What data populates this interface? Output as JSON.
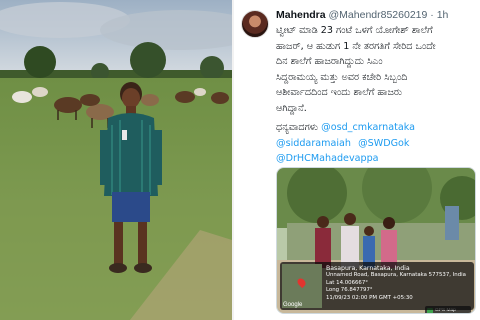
{
  "tweet": {
    "display_name": "Mahendra",
    "handle": "@Mahendr85260219",
    "separator": "·",
    "time": "1h",
    "body_lines": [
      "ಟ್ವೀಟ್ ಮಾಡಿ 23 ಗಂಟೆ ಒಳಗೆ ಯೋಗೇಶ್ ಶಾಲೆಗೆ",
      "ಹಾಜರ್, ಆ ಹುಡುಗ 1 ನೇ ತರಗತಿಗೆ ಸೇರಿದ ಒಂದೇ",
      "ದಿನ ಶಾಲೆಗೆ ಹಾಜರಾಗಿದ್ದುದು ಸಿಎಂ",
      "ಸಿದ್ದರಾಮಯ್ಯ ಮತ್ತು ಅವರ ಕಚೇರಿ ಸಿಬ್ಬಂದಿ",
      "ಆಶೀರ್ವಾದದಿಂದ ಇಂದು ಶಾಲೆಗೆ ಹಾಜರು",
      "ಆಗಿದ್ದಾನೆ."
    ],
    "thanks_label": "ಧನ್ಯವಾದಗಳು",
    "mentions": [
      "@osd_cmkarnataka",
      "@siddaramaiah",
      "@SWDGok",
      "@DrHCMahadevappa"
    ]
  },
  "gps": {
    "badge": "GPS Map Camera",
    "place": "Basapura, Karnataka, India",
    "address": "Unnamed Road, Basapura, Karnataka 577537, India",
    "lat": "Lat 14.006667°",
    "long": "Long 76.847797°",
    "timestamp": "11/09/23 02:00 PM GMT +05:30",
    "map_label": "Google"
  },
  "colors": {
    "link": "#1d9bf0",
    "text": "#0f1419",
    "muted": "#536471"
  }
}
